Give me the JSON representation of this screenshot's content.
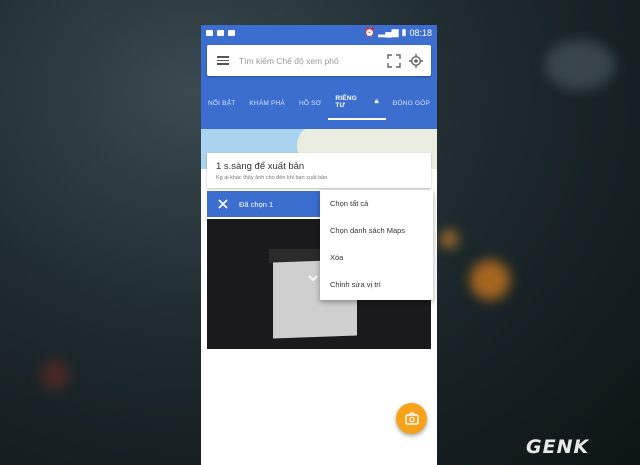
{
  "status_bar": {
    "time": "08:18",
    "left_icons": [
      "photo-icon",
      "photo-icon",
      "camera-icon"
    ],
    "right_icons": [
      "alarm-icon",
      "vibrate-icon",
      "signal-icon",
      "battery-icon"
    ]
  },
  "search": {
    "placeholder": "Tìm kiếm Chế độ xem phố"
  },
  "tabs": [
    {
      "label": "NỔI BẬT"
    },
    {
      "label": "KHÁM PHÁ"
    },
    {
      "label": "HỒ SƠ"
    },
    {
      "label": "RIÊNG TƯ"
    },
    {
      "label": "ĐÓNG GÓP"
    }
  ],
  "active_tab": "RIÊNG TƯ",
  "card": {
    "title": "1 s.sàng để xuất bản",
    "subtitle": "Kg ai khác thấy ảnh cho đến khi bạn xuất bản"
  },
  "selection": {
    "label": "Đã chọn 1"
  },
  "menu": {
    "items": [
      {
        "label": "Chọn tất cả"
      },
      {
        "label": "Chọn danh sách Maps"
      },
      {
        "label": "Xóa"
      },
      {
        "label": "Chỉnh sửa vị trí"
      }
    ]
  },
  "watermark": "GENK",
  "colors": {
    "primary": "#3b6ecf",
    "accent": "#f6a21a"
  }
}
